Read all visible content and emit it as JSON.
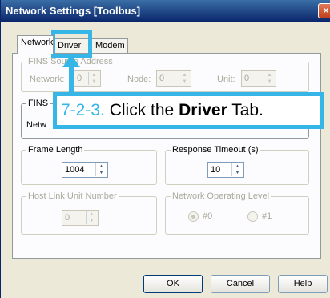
{
  "window": {
    "title": "Network Settings [Toolbus]",
    "close_glyph": "×"
  },
  "tabs": [
    {
      "label": "Network",
      "active": true
    },
    {
      "label": "Driver",
      "active": false
    },
    {
      "label": "Modem",
      "active": false
    }
  ],
  "fins_source": {
    "legend": "FINS Source Address",
    "network_label": "Network:",
    "network_value": "0",
    "node_label": "Node:",
    "node_value": "0",
    "unit_label": "Unit:",
    "unit_value": "0"
  },
  "fins_dest": {
    "legend": "FINS",
    "network_label": "Netw"
  },
  "frame_length": {
    "legend": "Frame Length",
    "value": "1004"
  },
  "response_timeout": {
    "legend": "Response Timeout (s)",
    "value": "10"
  },
  "host_link": {
    "legend": "Host Link Unit Number",
    "value": "0"
  },
  "network_level": {
    "legend": "Network Operating Level",
    "option0": "#0",
    "option1": "#1",
    "selected": "#0"
  },
  "buttons": {
    "ok": "OK",
    "cancel": "Cancel",
    "help": "Help"
  },
  "callout": {
    "step": "7-2-3.",
    "pre": "Click the",
    "bold": "Driver",
    "post": "Tab."
  },
  "colors": {
    "callout_accent": "#35b6e6",
    "titlebar": "#0a246a",
    "dialog_bg": "#ece9d8"
  }
}
